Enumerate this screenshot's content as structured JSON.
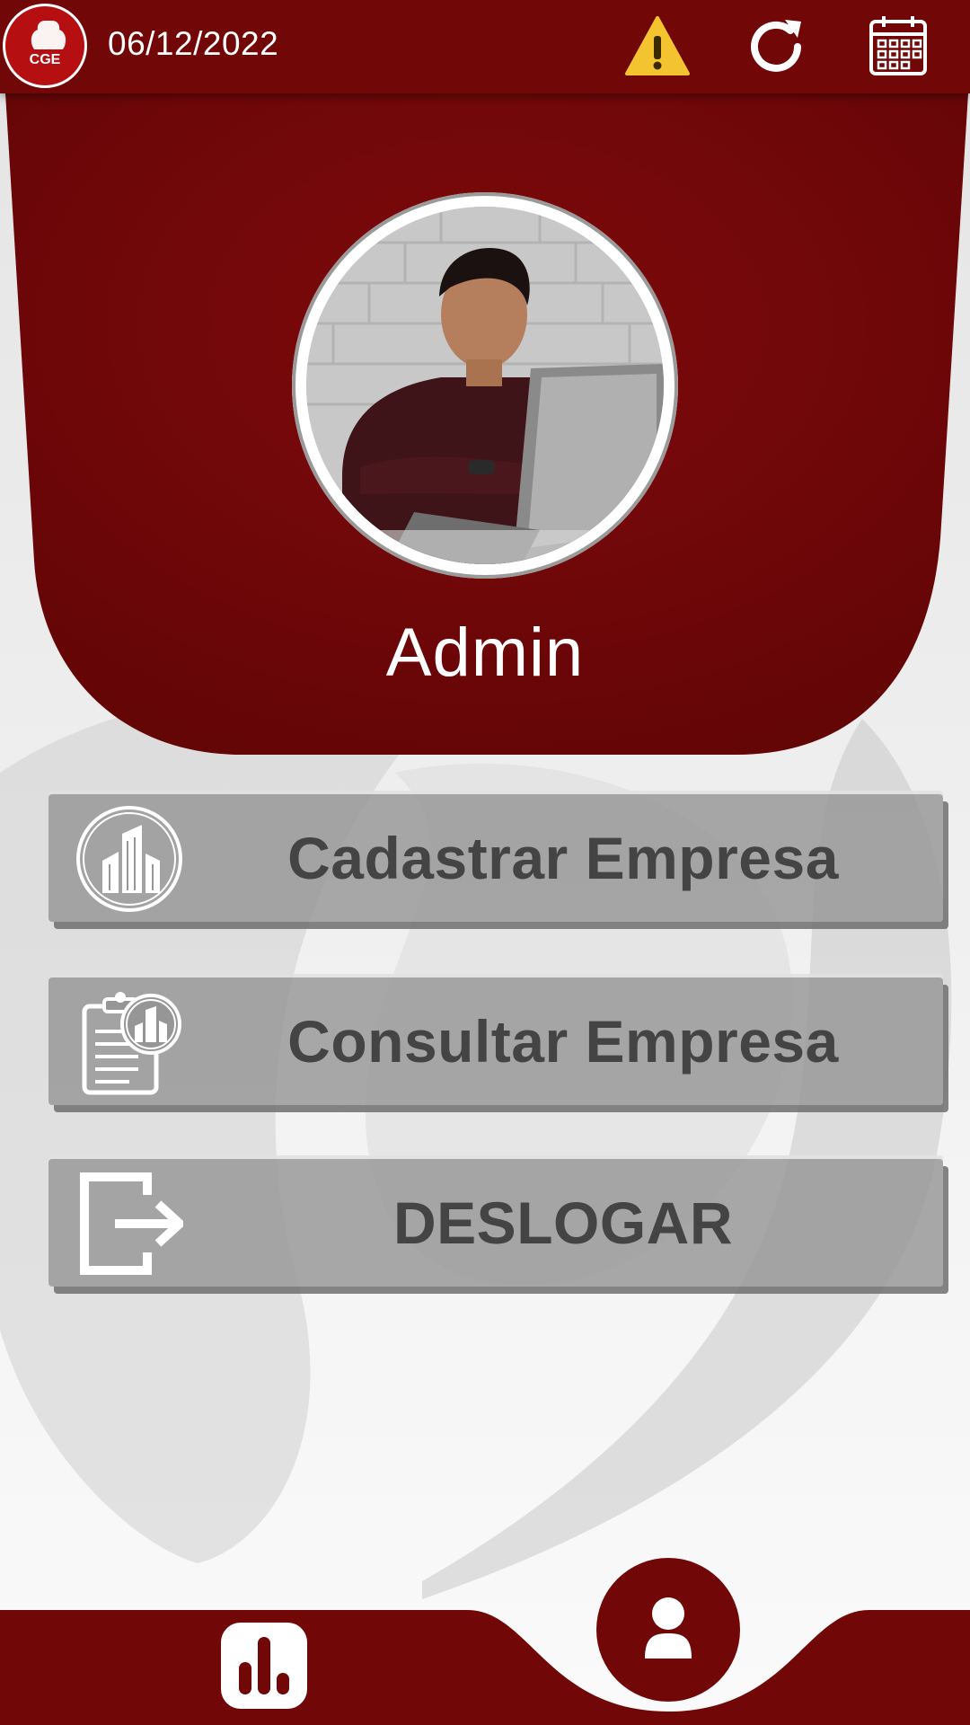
{
  "topbar": {
    "logo_text": "CGE",
    "date": "06/12/2022",
    "icons": [
      "warning-icon",
      "refresh-icon",
      "calendar-icon"
    ]
  },
  "profile": {
    "name": "Admin"
  },
  "menu": {
    "items": [
      {
        "label": "Cadastrar Empresa",
        "icon": "buildings-icon"
      },
      {
        "label": "Consultar Empresa",
        "icon": "clipboard-buildings-icon"
      },
      {
        "label": "DESLOGAR",
        "icon": "logout-icon"
      }
    ]
  },
  "bottom_nav": {
    "items": [
      "stats-icon",
      "user-icon"
    ],
    "active": "user-icon"
  },
  "colors": {
    "brand_red": "#720708",
    "button_grey": "#969696",
    "button_text": "#444444",
    "warning_yellow": "#f4c430"
  }
}
